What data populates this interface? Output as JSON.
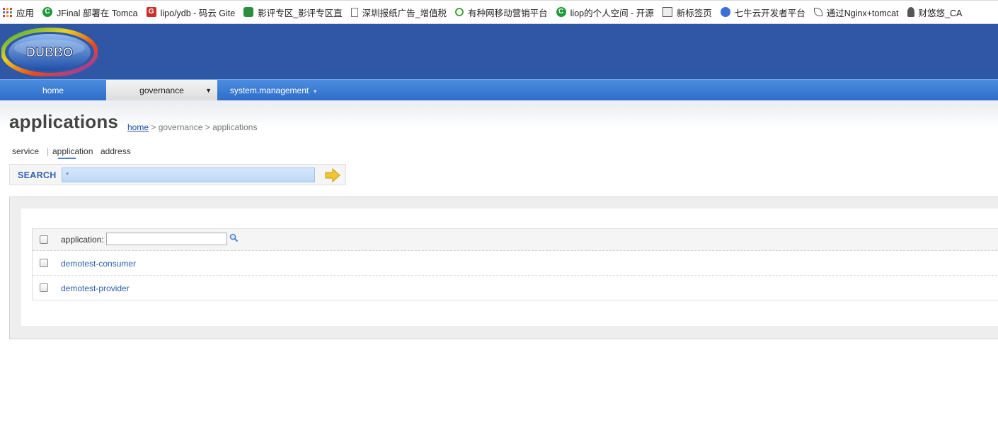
{
  "bookmarks": [
    {
      "label": "应用",
      "icon": "apps-grid-icon"
    },
    {
      "label": "JFinal 部署在 Tomca",
      "icon": "green-c-icon"
    },
    {
      "label": "lipo/ydb - 码云 Gite",
      "icon": "gitee-icon"
    },
    {
      "label": "影评专区_影评专区直",
      "icon": "panda-icon"
    },
    {
      "label": "深圳报纸广告_增值税",
      "icon": "page-icon"
    },
    {
      "label": "有种网移动营销平台",
      "icon": "eco-icon"
    },
    {
      "label": "liop的个人空间 - 开源",
      "icon": "green-c-icon"
    },
    {
      "label": "新标签页",
      "icon": "picture-icon"
    },
    {
      "label": "七牛云开发者平台",
      "icon": "qiniu-icon"
    },
    {
      "label": "通过Nginx+tomcat",
      "icon": "leaf-icon"
    },
    {
      "label": "财悠悠_CA",
      "icon": "person-icon"
    }
  ],
  "logo": {
    "text": "DUBBO"
  },
  "nav": {
    "home": "home",
    "governance": "governance",
    "governance_arrow": "▼",
    "system_management": "system.management",
    "system_arrow": "▼"
  },
  "page": {
    "title": "applications",
    "breadcrumb": {
      "home": "home",
      "rest": " > governance > applications"
    }
  },
  "subtabs": {
    "service": "service",
    "separator": "|",
    "application": "application",
    "address": "address"
  },
  "search": {
    "label": "SEARCH",
    "value": "*"
  },
  "table": {
    "header_label": "application:",
    "header_input_value": "",
    "rows": [
      {
        "name": "demotest-consumer"
      },
      {
        "name": "demotest-provider"
      }
    ]
  },
  "colors": {
    "header_bg": "#2f57a5",
    "nav_bg": "#3a7ad4",
    "link": "#2b5fae",
    "search_label": "#2f62b5"
  }
}
